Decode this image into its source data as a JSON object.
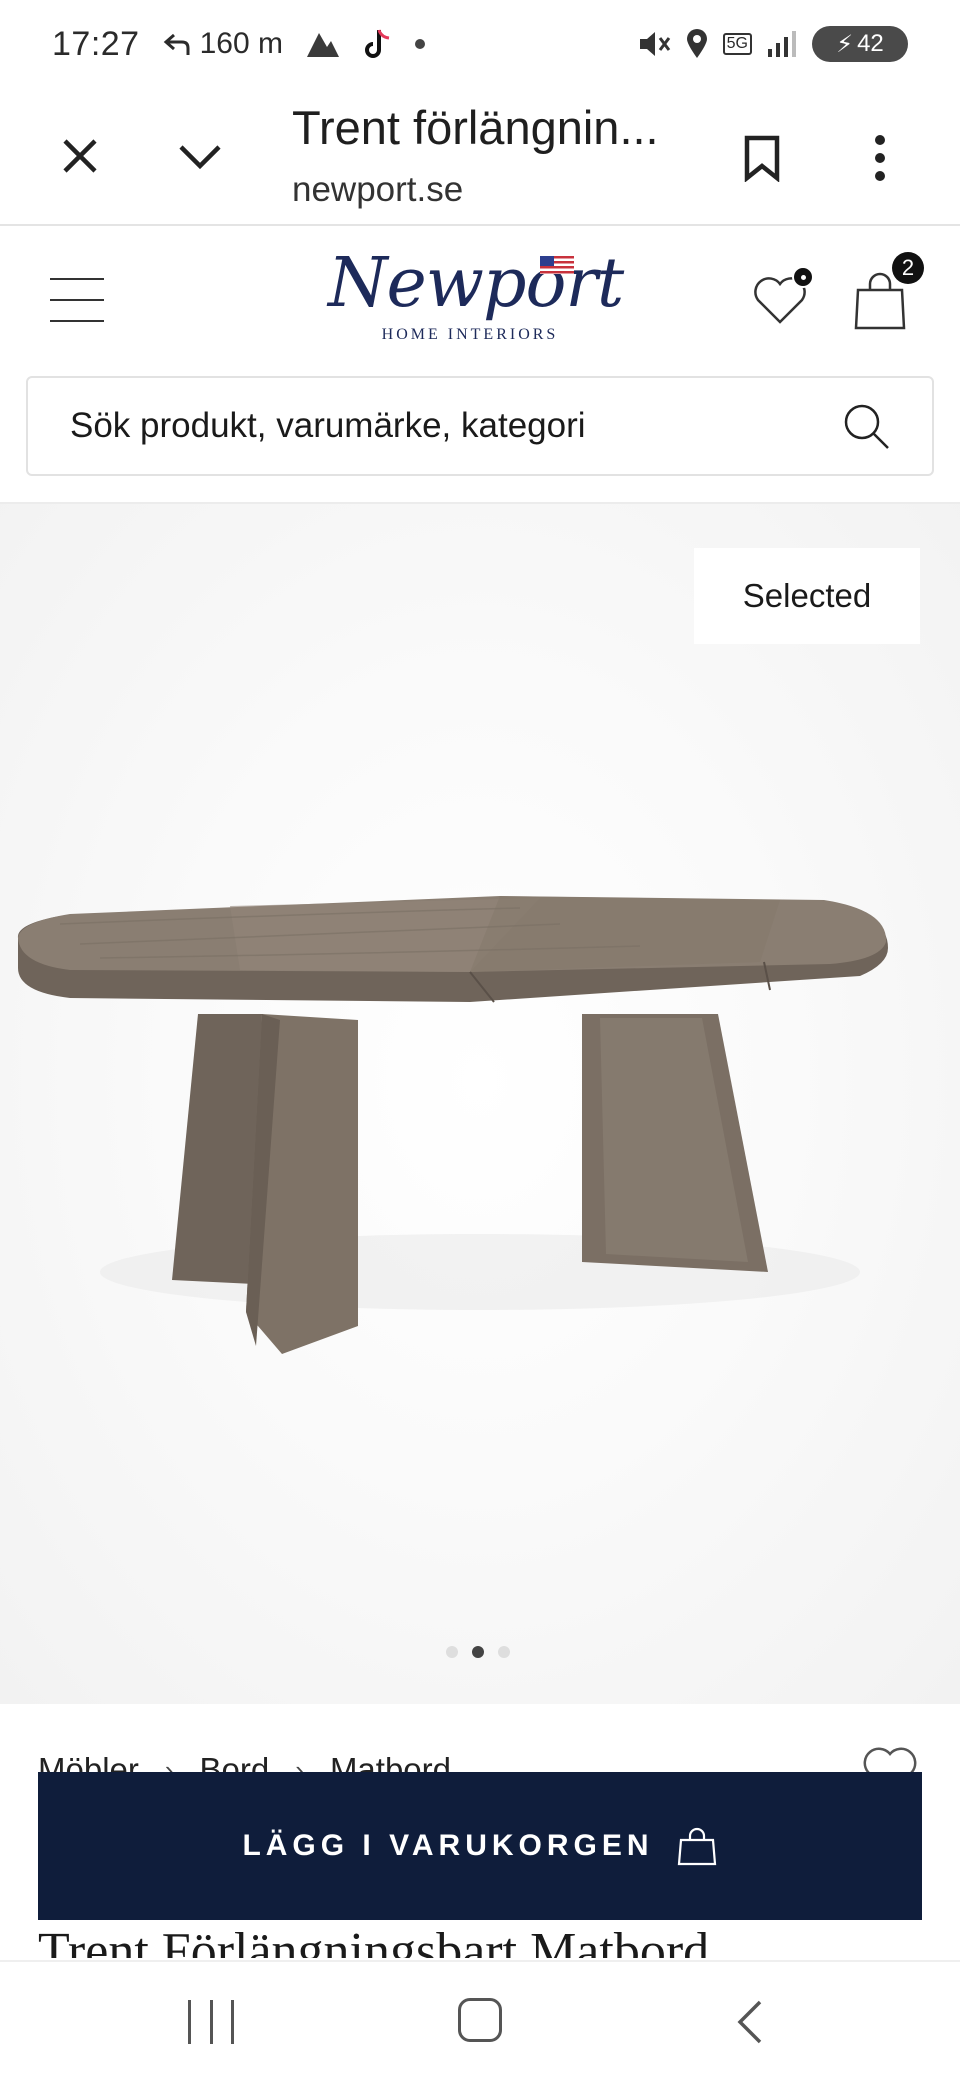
{
  "status_bar": {
    "time": "17:27",
    "nav_distance": "160 m",
    "battery": "42",
    "network": "5G"
  },
  "browser": {
    "title": "Trent förlängnin...",
    "url": "newport.se"
  },
  "header": {
    "logo_text": "Newport",
    "logo_subtitle": "HOME INTERIORS",
    "cart_count": "2"
  },
  "search": {
    "placeholder": "Sök produkt, varumärke, kategori"
  },
  "gallery": {
    "badge": "Selected",
    "current_slide": 2,
    "total_slides": 3
  },
  "breadcrumb": [
    "Möbler",
    "Bord",
    "Matbord"
  ],
  "product": {
    "title": "Trent Förlängningsbart Matbord"
  },
  "cta": {
    "add_to_cart_label": "LÄGG I VARUKORGEN"
  },
  "colors": {
    "brand_navy": "#0f1d3b",
    "logo_blue": "#1d2a5a",
    "wood": "#7a6e63"
  }
}
